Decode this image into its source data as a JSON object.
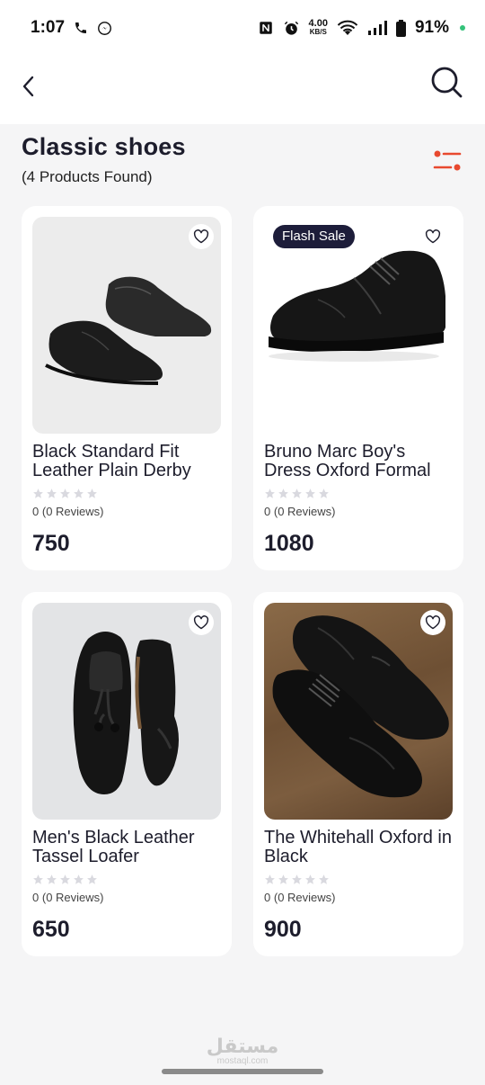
{
  "status": {
    "time": "1:07",
    "net_speed_value": "4.00",
    "net_speed_unit": "KB/S",
    "battery": "91%",
    "icons": [
      "phone-icon",
      "messenger-icon",
      "nfc-icon",
      "alarm-icon",
      "wifi-icon",
      "signal-icon",
      "battery-icon"
    ]
  },
  "header": {
    "back_icon": "chevron-left-icon",
    "search_icon": "search-icon"
  },
  "page": {
    "title": "Classic shoes",
    "count_text": "(4 Products Found)",
    "filter_icon": "filter-icon"
  },
  "products": [
    {
      "name": "Black Standard Fit Leather Plain Derby",
      "rating": "0",
      "reviews": "(0  Reviews)",
      "price": "750",
      "badge": "",
      "icon": "heart-outline-icon"
    },
    {
      "name": "Bruno Marc Boy's Dress Oxford Formal",
      "rating": "0",
      "reviews": "(0  Reviews)",
      "price": "1080",
      "badge": "Flash Sale",
      "icon": "heart-outline-icon"
    },
    {
      "name": "Men's Black Leather Tassel Loafer",
      "rating": "0",
      "reviews": "(0  Reviews)",
      "price": "650",
      "badge": "",
      "icon": "heart-outline-icon"
    },
    {
      "name": "The Whitehall Oxford in Black",
      "rating": "0",
      "reviews": "(0  Reviews)",
      "price": "900",
      "badge": "",
      "icon": "heart-outline-icon"
    }
  ],
  "watermark": {
    "main": "مستقل",
    "sub": "mostaql.com"
  },
  "colors": {
    "accent": "#e8492f",
    "badge_bg": "#1d1d3a",
    "background": "#f5f5f6",
    "card": "#ffffff",
    "star_empty": "#d9d9df"
  }
}
